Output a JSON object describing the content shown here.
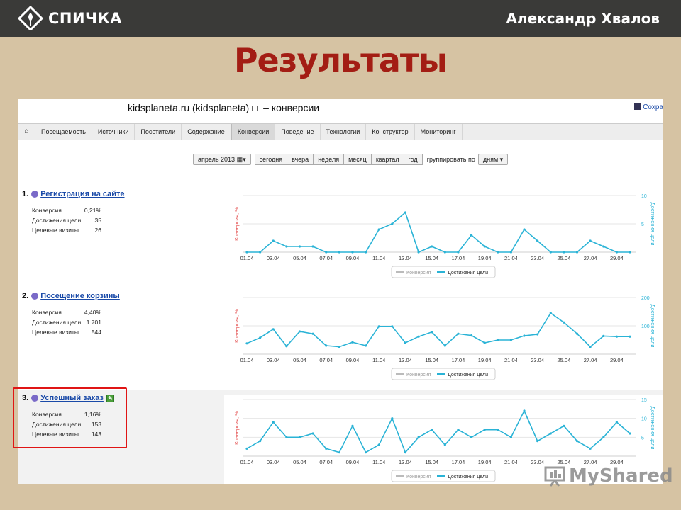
{
  "header": {
    "brand": "СПИЧКА",
    "author": "Александр Хвалов"
  },
  "slide_title": "Результаты",
  "screenshot": {
    "site_title": "kidsplaneta.ru (kidsplaneta)",
    "section": "– конверсии",
    "save_label": "Сохра",
    "menu": [
      "Посещаемость",
      "Источники",
      "Посетители",
      "Содержание",
      "Конверсии",
      "Поведение",
      "Технологии",
      "Конструктор",
      "Мониторинг"
    ],
    "active_menu": "Конверсии",
    "period": {
      "month": "апрель 2013",
      "buttons": [
        "сегодня",
        "вчера",
        "неделя",
        "месяц",
        "квартал",
        "год"
      ],
      "group_label": "группировать по",
      "group_value": "дням"
    },
    "stat_labels": {
      "conversion": "Конверсия",
      "achievements": "Достижения цели",
      "visits": "Целевые визиты"
    }
  },
  "goals": [
    {
      "number": "1.",
      "name": "Регистрация на сайте",
      "conversion": "0,21%",
      "achievements": "35",
      "visits": "26"
    },
    {
      "number": "2.",
      "name": "Посещение корзины",
      "conversion": "4,40%",
      "achievements": "1 701",
      "visits": "544"
    },
    {
      "number": "3.",
      "name": "Успешный заказ",
      "conversion": "1,16%",
      "achievements": "153",
      "visits": "143"
    }
  ],
  "chart_data": [
    {
      "type": "line",
      "x": [
        "01.04",
        "02.04",
        "03.04",
        "04.04",
        "05.04",
        "06.04",
        "07.04",
        "08.04",
        "09.04",
        "10.04",
        "11.04",
        "12.04",
        "13.04",
        "14.04",
        "15.04",
        "16.04",
        "17.04",
        "18.04",
        "19.04",
        "20.04",
        "21.04",
        "22.04",
        "23.04",
        "24.04",
        "25.04",
        "26.04",
        "27.04",
        "28.04",
        "29.04",
        "30.04"
      ],
      "x_ticks": [
        "01.04",
        "03.04",
        "05.04",
        "07.04",
        "09.04",
        "11.04",
        "13.04",
        "15.04",
        "17.04",
        "19.04",
        "21.04",
        "23.04",
        "25.04",
        "27.04",
        "29.04"
      ],
      "ylabel": "Конверсия, %",
      "y2label": "Достижения цели",
      "y2_ticks": [
        "10",
        "5"
      ],
      "y2lim": [
        0,
        10
      ],
      "legend": [
        "Конверсия",
        "Достижения цели"
      ],
      "series": [
        {
          "name": "Достижения цели",
          "axis": "right",
          "values": [
            0,
            0,
            2,
            1,
            1,
            1,
            0,
            0,
            0,
            0,
            4,
            5,
            7,
            0,
            1,
            0,
            0,
            3,
            1,
            0,
            0,
            4,
            2,
            0,
            0,
            0,
            2,
            1,
            0,
            0
          ]
        }
      ]
    },
    {
      "type": "line",
      "x": [
        "01.04",
        "02.04",
        "03.04",
        "04.04",
        "05.04",
        "06.04",
        "07.04",
        "08.04",
        "09.04",
        "10.04",
        "11.04",
        "12.04",
        "13.04",
        "14.04",
        "15.04",
        "16.04",
        "17.04",
        "18.04",
        "19.04",
        "20.04",
        "21.04",
        "22.04",
        "23.04",
        "24.04",
        "25.04",
        "26.04",
        "27.04",
        "28.04",
        "29.04",
        "30.04"
      ],
      "x_ticks": [
        "01.04",
        "03.04",
        "05.04",
        "07.04",
        "09.04",
        "11.04",
        "13.04",
        "15.04",
        "17.04",
        "19.04",
        "21.04",
        "23.04",
        "25.04",
        "27.04",
        "29.04"
      ],
      "ylabel": "Конверсия, %",
      "y2label": "Достижения цели",
      "y2_ticks": [
        "200",
        "100"
      ],
      "y2lim": [
        0,
        200
      ],
      "legend": [
        "Конверсия",
        "Достижения цели"
      ],
      "series": [
        {
          "name": "Достижения цели",
          "axis": "right",
          "values": [
            38,
            58,
            88,
            28,
            80,
            72,
            30,
            26,
            42,
            30,
            98,
            98,
            40,
            62,
            78,
            30,
            72,
            66,
            40,
            50,
            50,
            65,
            70,
            145,
            112,
            72,
            26,
            64,
            62,
            62
          ]
        }
      ]
    },
    {
      "type": "line",
      "x": [
        "01.04",
        "02.04",
        "03.04",
        "04.04",
        "05.04",
        "06.04",
        "07.04",
        "08.04",
        "09.04",
        "10.04",
        "11.04",
        "12.04",
        "13.04",
        "14.04",
        "15.04",
        "16.04",
        "17.04",
        "18.04",
        "19.04",
        "20.04",
        "21.04",
        "22.04",
        "23.04",
        "24.04",
        "25.04",
        "26.04",
        "27.04",
        "28.04",
        "29.04",
        "30.04"
      ],
      "x_ticks": [
        "01.04",
        "03.04",
        "05.04",
        "07.04",
        "09.04",
        "11.04",
        "13.04",
        "15.04",
        "17.04",
        "19.04",
        "21.04",
        "23.04",
        "25.04",
        "27.04",
        "29.04"
      ],
      "ylabel": "Конверсия, %",
      "y2label": "Достижения цели",
      "y2_ticks": [
        "15",
        "10",
        "5"
      ],
      "y2lim": [
        0,
        15
      ],
      "legend": [
        "Конверсия",
        "Достижения цели"
      ],
      "series": [
        {
          "name": "Достижения цели",
          "axis": "right",
          "values": [
            2,
            4,
            9,
            5,
            5,
            6,
            2,
            1,
            8,
            1,
            3,
            10,
            1,
            5,
            7,
            3,
            7,
            5,
            7,
            7,
            5,
            12,
            4,
            6,
            8,
            4,
            2,
            5,
            9,
            6
          ]
        }
      ]
    }
  ],
  "colors": {
    "accent_red": "#a31d14",
    "series_line": "#2ab3d6",
    "axis_left": "#e34a4a",
    "highlight": "#e01515"
  },
  "watermark": "MyShared"
}
